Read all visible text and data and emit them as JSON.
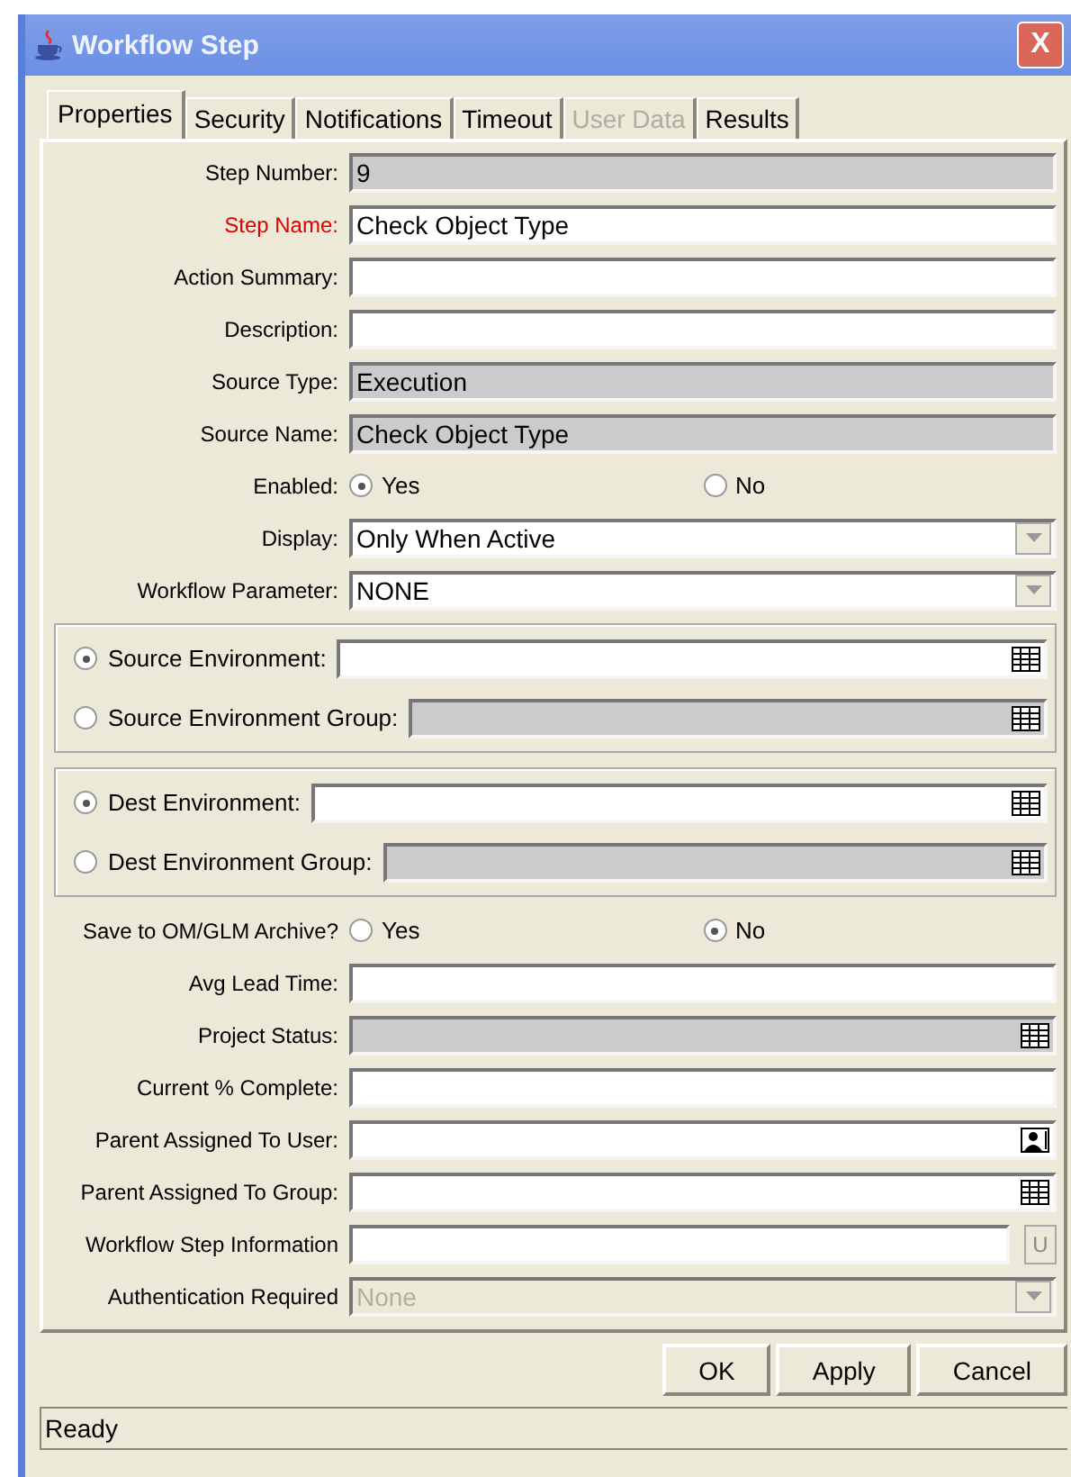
{
  "window": {
    "title": "Workflow Step",
    "close": "X"
  },
  "tabs": [
    {
      "label": "Properties",
      "selected": true,
      "disabled": false
    },
    {
      "label": "Security",
      "selected": false,
      "disabled": false
    },
    {
      "label": "Notifications",
      "selected": false,
      "disabled": false
    },
    {
      "label": "Timeout",
      "selected": false,
      "disabled": false
    },
    {
      "label": "User Data",
      "selected": false,
      "disabled": true
    },
    {
      "label": "Results",
      "selected": false,
      "disabled": false
    }
  ],
  "sections": [
    {
      "kind": "fields",
      "rows": [
        {
          "kind": "text",
          "label": "Step Number:",
          "value": "9",
          "disabled": true,
          "required": false
        },
        {
          "kind": "text",
          "label": "Step Name:",
          "value": "Check Object Type",
          "disabled": false,
          "required": true
        },
        {
          "kind": "text",
          "label": "Action Summary:",
          "disabled": false,
          "required": false
        },
        {
          "kind": "text",
          "label": "Description:",
          "disabled": false,
          "required": false
        },
        {
          "kind": "text",
          "label": "Source Type:",
          "value": "Execution",
          "disabled": true,
          "required": false
        },
        {
          "kind": "text",
          "label": "Source Name:",
          "value": "Check Object Type",
          "disabled": true,
          "required": false
        },
        {
          "kind": "radio",
          "label": "Enabled:",
          "options": [
            {
              "label": "Yes",
              "selected": true
            },
            {
              "label": "No",
              "selected": false
            }
          ]
        },
        {
          "kind": "dropdown",
          "label": "Display:",
          "value": "Only When Active",
          "disabled": false
        },
        {
          "kind": "dropdown",
          "label": "Workflow Parameter:",
          "value": "NONE",
          "disabled": false
        }
      ]
    },
    {
      "kind": "group",
      "rows": [
        {
          "label": "Source Environment:",
          "selected": true,
          "disabled": false
        },
        {
          "label": "Source Environment Group:",
          "selected": false,
          "disabled": true
        }
      ]
    },
    {
      "kind": "group",
      "rows": [
        {
          "label": "Dest Environment:",
          "selected": true,
          "disabled": false
        },
        {
          "label": "Dest Environment Group:",
          "selected": false,
          "disabled": true
        }
      ]
    },
    {
      "kind": "fields",
      "rows": [
        {
          "kind": "radio",
          "label": "Save to OM/GLM Archive?",
          "options": [
            {
              "label": "Yes",
              "selected": false
            },
            {
              "label": "No",
              "selected": true
            }
          ]
        },
        {
          "kind": "text",
          "label": "Avg Lead Time:",
          "disabled": false,
          "required": false
        },
        {
          "kind": "lookup",
          "label": "Project Status:",
          "disabled": true
        },
        {
          "kind": "text",
          "label": "Current % Complete:",
          "disabled": false,
          "required": false
        },
        {
          "kind": "user-lookup",
          "label": "Parent Assigned To User:",
          "disabled": false
        },
        {
          "kind": "lookup",
          "label": "Parent Assigned To Group:",
          "disabled": false
        },
        {
          "kind": "button-field",
          "label": "Workflow Step Information",
          "button": "U"
        },
        {
          "kind": "dropdown",
          "label": "Authentication Required",
          "value": "None",
          "disabled": true
        }
      ]
    }
  ],
  "buttons": [
    "OK",
    "Apply",
    "Cancel"
  ],
  "status_bar": "Ready"
}
